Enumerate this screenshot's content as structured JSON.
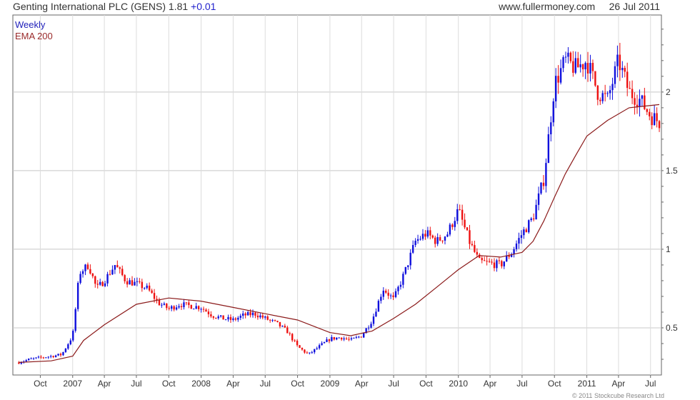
{
  "header": {
    "title": "Genting International PLC (GENS)",
    "price": "1.81",
    "change": "+0.01",
    "site": "www.fullermoney.com",
    "date": "26 Jul 2011"
  },
  "legend": {
    "weekly": "Weekly",
    "ema": "EMA 200"
  },
  "copyright": "© 2011 Stockcube Research Ltd",
  "colors": {
    "up": "#1010dd",
    "down": "#ee1111",
    "ema": "#8b1a1a",
    "grid": "#d8d8d8",
    "frame": "#666666"
  },
  "chart_data": {
    "type": "line",
    "series_style": "weekly candlestick + EMA line",
    "xlabel": "",
    "ylabel": "",
    "ylim": [
      0.2,
      2.49
    ],
    "yticks": [
      0.5,
      1,
      1.5,
      2
    ],
    "ytick_labels": [
      "0.5",
      "1",
      "1.5",
      "2"
    ],
    "grid": true,
    "y_axis_side": "right",
    "xticks": [
      {
        "x": "2006-10-01",
        "label": "Oct"
      },
      {
        "x": "2007-01-01",
        "label": "2007"
      },
      {
        "x": "2007-04-01",
        "label": "Apr"
      },
      {
        "x": "2007-07-01",
        "label": "Jul"
      },
      {
        "x": "2007-10-01",
        "label": "Oct"
      },
      {
        "x": "2008-01-01",
        "label": "2008"
      },
      {
        "x": "2008-04-01",
        "label": "Apr"
      },
      {
        "x": "2008-07-01",
        "label": "Jul"
      },
      {
        "x": "2008-10-01",
        "label": "Oct"
      },
      {
        "x": "2009-01-01",
        "label": "2009"
      },
      {
        "x": "2009-04-01",
        "label": "Apr"
      },
      {
        "x": "2009-07-01",
        "label": "Jul"
      },
      {
        "x": "2009-10-01",
        "label": "Oct"
      },
      {
        "x": "2010-01-01",
        "label": "2010"
      },
      {
        "x": "2010-04-01",
        "label": "Apr"
      },
      {
        "x": "2010-07-01",
        "label": "Jul"
      },
      {
        "x": "2010-10-01",
        "label": "Oct"
      },
      {
        "x": "2011-01-01",
        "label": "2011"
      },
      {
        "x": "2011-04-01",
        "label": "Apr"
      },
      {
        "x": "2011-07-01",
        "label": "Jul"
      }
    ],
    "price_series": {
      "name": "Weekly",
      "x": [
        "2006-08-01",
        "2006-09-01",
        "2006-10-01",
        "2006-11-01",
        "2006-12-01",
        "2007-01-01",
        "2007-01-20",
        "2007-02-15",
        "2007-03-10",
        "2007-04-01",
        "2007-05-01",
        "2007-06-01",
        "2007-07-01",
        "2007-08-01",
        "2007-09-01",
        "2007-10-01",
        "2007-11-01",
        "2007-12-01",
        "2008-01-01",
        "2008-02-01",
        "2008-03-01",
        "2008-04-01",
        "2008-05-01",
        "2008-06-01",
        "2008-07-01",
        "2008-08-01",
        "2008-09-01",
        "2008-10-01",
        "2008-11-01",
        "2008-12-01",
        "2009-01-01",
        "2009-02-01",
        "2009-03-01",
        "2009-04-01",
        "2009-05-01",
        "2009-06-01",
        "2009-07-01",
        "2009-08-01",
        "2009-09-01",
        "2009-10-01",
        "2009-11-01",
        "2009-12-01",
        "2010-01-01",
        "2010-02-01",
        "2010-03-01",
        "2010-04-01",
        "2010-05-01",
        "2010-06-01",
        "2010-07-01",
        "2010-08-01",
        "2010-09-01",
        "2010-10-01",
        "2010-11-01",
        "2010-12-01",
        "2011-01-01",
        "2011-02-01",
        "2011-03-01",
        "2011-04-01",
        "2011-05-01",
        "2011-06-01",
        "2011-07-01",
        "2011-07-26"
      ],
      "y": [
        0.28,
        0.3,
        0.31,
        0.32,
        0.33,
        0.45,
        0.85,
        0.9,
        0.75,
        0.8,
        0.9,
        0.8,
        0.78,
        0.75,
        0.66,
        0.62,
        0.65,
        0.64,
        0.63,
        0.58,
        0.56,
        0.55,
        0.58,
        0.59,
        0.56,
        0.53,
        0.48,
        0.38,
        0.33,
        0.38,
        0.43,
        0.44,
        0.42,
        0.45,
        0.55,
        0.75,
        0.68,
        0.85,
        1.05,
        1.1,
        1.05,
        1.1,
        1.25,
        1.05,
        0.92,
        0.91,
        0.9,
        0.98,
        1.1,
        1.2,
        1.45,
        2.05,
        2.2,
        2.15,
        2.2,
        2.0,
        1.95,
        2.2,
        2.0,
        1.95,
        1.85,
        1.81
      ]
    },
    "ema_series": {
      "name": "EMA 200",
      "x": [
        "2006-08-01",
        "2006-11-01",
        "2007-01-01",
        "2007-02-01",
        "2007-04-01",
        "2007-07-01",
        "2007-10-01",
        "2008-01-01",
        "2008-04-01",
        "2008-07-01",
        "2008-10-01",
        "2009-01-01",
        "2009-03-01",
        "2009-05-01",
        "2009-07-01",
        "2009-09-01",
        "2009-11-01",
        "2010-01-01",
        "2010-03-01",
        "2010-05-01",
        "2010-07-01",
        "2010-08-01",
        "2010-09-01",
        "2010-10-01",
        "2010-11-01",
        "2010-12-01",
        "2011-01-01",
        "2011-03-01",
        "2011-05-01",
        "2011-07-26"
      ],
      "y": [
        0.28,
        0.29,
        0.32,
        0.42,
        0.52,
        0.65,
        0.69,
        0.67,
        0.63,
        0.59,
        0.55,
        0.47,
        0.45,
        0.48,
        0.56,
        0.65,
        0.76,
        0.87,
        0.96,
        0.95,
        0.98,
        1.05,
        1.18,
        1.33,
        1.48,
        1.6,
        1.72,
        1.82,
        1.9,
        1.92
      ]
    }
  }
}
